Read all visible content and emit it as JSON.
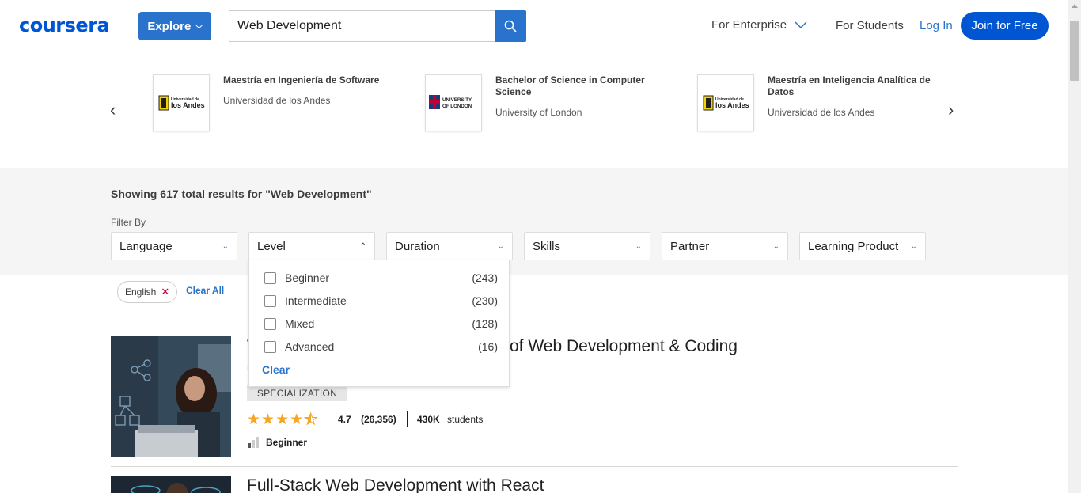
{
  "header": {
    "logo": "coursera",
    "explore_label": "Explore",
    "search_value": "Web Development",
    "nav_enterprise": "For Enterprise",
    "nav_students": "For Students",
    "nav_login": "Log In",
    "join_label": "Join for Free"
  },
  "degrees": [
    {
      "title": "Maestría en Ingeniería de Software",
      "partner": "Universidad de los Andes",
      "logo_text": "los Andes",
      "logo_small": "Universidad de"
    },
    {
      "title": "Bachelor of Science in Computer Science",
      "partner": "University of London",
      "logo_text": "UNIVERSITY OF LONDON"
    },
    {
      "title": "Maestría en Inteligencia Analítica de Datos",
      "partner": "Universidad de los Andes",
      "logo_text": "los Andes",
      "logo_small": "Universidad de"
    }
  ],
  "results": {
    "summary": "Showing 617 total results for \"Web Development\"",
    "filter_by_label": "Filter By"
  },
  "filters": [
    {
      "label": "Language"
    },
    {
      "label": "Level"
    },
    {
      "label": "Duration"
    },
    {
      "label": "Skills"
    },
    {
      "label": "Partner"
    },
    {
      "label": "Learning Product"
    }
  ],
  "level_dropdown": {
    "options": [
      {
        "label": "Beginner",
        "count": "(243)"
      },
      {
        "label": "Intermediate",
        "count": "(230)"
      },
      {
        "label": "Mixed",
        "count": "(128)"
      },
      {
        "label": "Advanced",
        "count": "(16)"
      }
    ],
    "clear_label": "Clear"
  },
  "active_chips": {
    "chip_label": "English",
    "clear_all_label": "Clear All"
  },
  "courses": [
    {
      "title_visible_prefix": "W",
      "title_visible_suffix": "of Web Development & Coding",
      "partner_visible": "U",
      "type": "SPECIALIZATION",
      "rating": "4.7",
      "rating_count": "(26,356)",
      "students": "430K",
      "students_label": "students",
      "level": "Beginner",
      "stars_filled": 4.5
    },
    {
      "title": "Full-Stack Web Development with React"
    }
  ],
  "colors": {
    "brand": "#0056d2",
    "accent": "#2a73cc",
    "star": "#f5a623",
    "chip_x": "#c3002f"
  }
}
